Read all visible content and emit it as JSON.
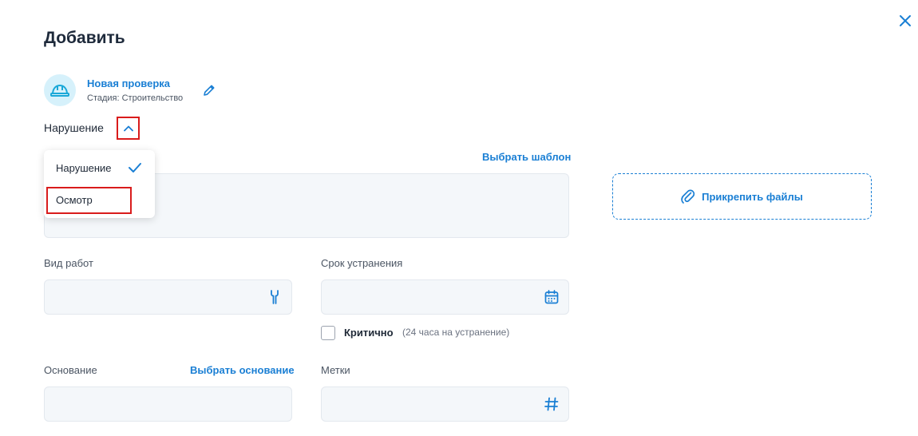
{
  "dialog": {
    "title": "Добавить"
  },
  "check": {
    "name": "Новая проверка",
    "stage": "Стадия: Строительство"
  },
  "record_type": {
    "selected": "Нарушение",
    "options": [
      {
        "label": "Нарушение",
        "checked": true
      },
      {
        "label": "Осмотр",
        "checked": false
      }
    ]
  },
  "description": {
    "template_link": "Выбрать шаблон",
    "value": ""
  },
  "attachments": {
    "label": "Прикрепить файлы"
  },
  "work_type": {
    "label": "Вид работ",
    "value": ""
  },
  "deadline": {
    "label": "Срок устранения",
    "value": ""
  },
  "critical": {
    "label": "Критично",
    "note": "(24 часа на устранение)",
    "checked": false
  },
  "basis": {
    "label": "Основание",
    "link": "Выбрать основание",
    "value": ""
  },
  "tags": {
    "label": "Метки",
    "value": ""
  },
  "colors": {
    "accent": "#1a7fd4",
    "highlight": "#d91c1c",
    "field_bg": "#f4f7fa"
  },
  "icons": {
    "close": "close-icon",
    "avatar": "hard-hat-icon",
    "edit": "pencil-icon",
    "chevron": "chevron-up-icon",
    "check": "checkmark-icon",
    "attach": "paperclip-icon",
    "work_type": "wrench-icon",
    "deadline": "calendar-icon",
    "tags": "hashtag-icon"
  }
}
